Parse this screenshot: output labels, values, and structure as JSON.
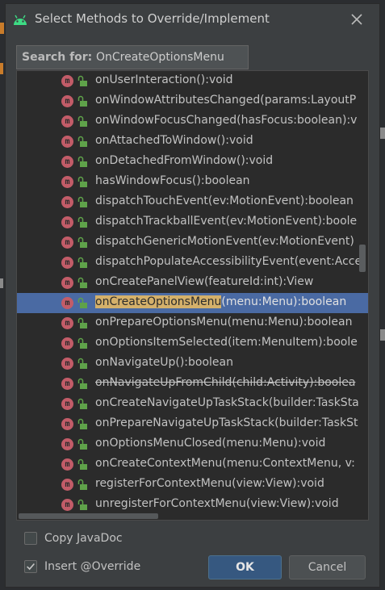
{
  "dialog": {
    "title": "Select Methods to Override/Implement",
    "search_label": "Search for:",
    "search_value": "OnCreateOptionsMenu"
  },
  "methods": [
    {
      "name": "onUserInteraction():void"
    },
    {
      "name": "onWindowAttributesChanged(params:LayoutP"
    },
    {
      "name": "onWindowFocusChanged(hasFocus:boolean):v"
    },
    {
      "name": "onAttachedToWindow():void"
    },
    {
      "name": "onDetachedFromWindow():void"
    },
    {
      "name": "hasWindowFocus():boolean"
    },
    {
      "name": "dispatchTouchEvent(ev:MotionEvent):boolean"
    },
    {
      "name": "dispatchTrackballEvent(ev:MotionEvent):boole"
    },
    {
      "name": "dispatchGenericMotionEvent(ev:MotionEvent)"
    },
    {
      "name": "dispatchPopulateAccessibilityEvent(event:Acce"
    },
    {
      "name": "onCreatePanelView(featureId:int):View"
    },
    {
      "name_match": "onCreateOptionsMenu",
      "name_rest": "(menu:Menu):boolean",
      "selected": true
    },
    {
      "name": "onPrepareOptionsMenu(menu:Menu):boolean"
    },
    {
      "name": "onOptionsItemSelected(item:MenuItem):boole"
    },
    {
      "name": "onNavigateUp():boolean"
    },
    {
      "name": "onNavigateUpFromChild(child:Activity):boolea",
      "deprecated": true
    },
    {
      "name": "onCreateNavigateUpTaskStack(builder:TaskSta"
    },
    {
      "name": "onPrepareNavigateUpTaskStack(builder:TaskSt"
    },
    {
      "name": "onOptionsMenuClosed(menu:Menu):void"
    },
    {
      "name": "onCreateContextMenu(menu:ContextMenu, v:"
    },
    {
      "name": "registerForContextMenu(view:View):void"
    },
    {
      "name": "unregisterForContextMenu(view:View):void"
    }
  ],
  "options": {
    "copy_javadoc": "Copy JavaDoc",
    "copy_javadoc_checked": false,
    "insert_override": "Insert @Override",
    "insert_override_checked": true
  },
  "buttons": {
    "ok": "OK",
    "cancel": "Cancel"
  },
  "colors": {
    "method_icon": "#c25c68",
    "lock_icon": "#5fa24a",
    "selection": "#4a6aa3",
    "search_match": "#d4b06a"
  }
}
